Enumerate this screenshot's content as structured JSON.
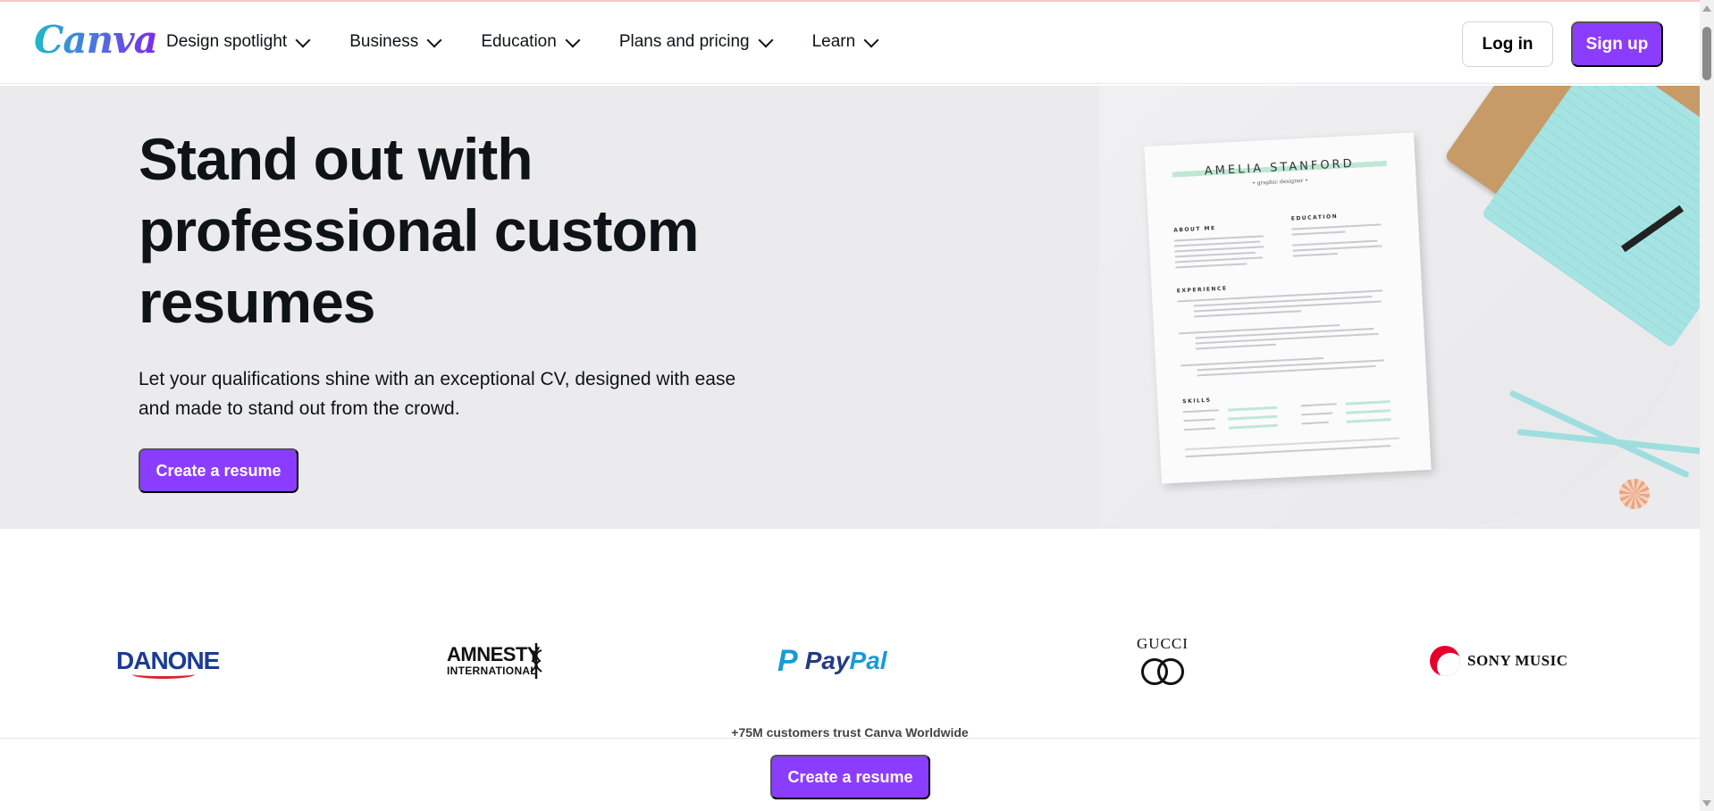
{
  "header": {
    "logo_text": "Canva",
    "nav": [
      {
        "label": "Design spotlight"
      },
      {
        "label": "Business"
      },
      {
        "label": "Education"
      },
      {
        "label": "Plans and pricing"
      },
      {
        "label": "Learn"
      }
    ],
    "login_label": "Log in",
    "signup_label": "Sign up"
  },
  "hero": {
    "title": "Stand out with professional custom resumes",
    "subtitle": "Let your qualifications shine with an exceptional CV, designed with ease and made to stand out from the crowd.",
    "cta_label": "Create a resume",
    "resume_preview": {
      "name": "AMELIA STANFORD",
      "role": "• graphic designer •",
      "sections": [
        "ABOUT ME",
        "EDUCATION",
        "EXPERIENCE",
        "SKILLS"
      ]
    }
  },
  "logos": {
    "items": [
      {
        "name": "DANONE"
      },
      {
        "name": "AMNESTY",
        "sub": "INTERNATIONAL"
      },
      {
        "name": "PayPal",
        "part1": "Pay",
        "part2": "Pal"
      },
      {
        "name": "GUCCI"
      },
      {
        "name": "SONY MUSIC"
      }
    ],
    "trust_text": "+75M customers trust Canva Worldwide"
  },
  "sticky": {
    "cta_label": "Create a resume"
  },
  "colors": {
    "accent": "#8b3dff",
    "hero_bg": "#ebebed",
    "text": "#0e1318"
  }
}
